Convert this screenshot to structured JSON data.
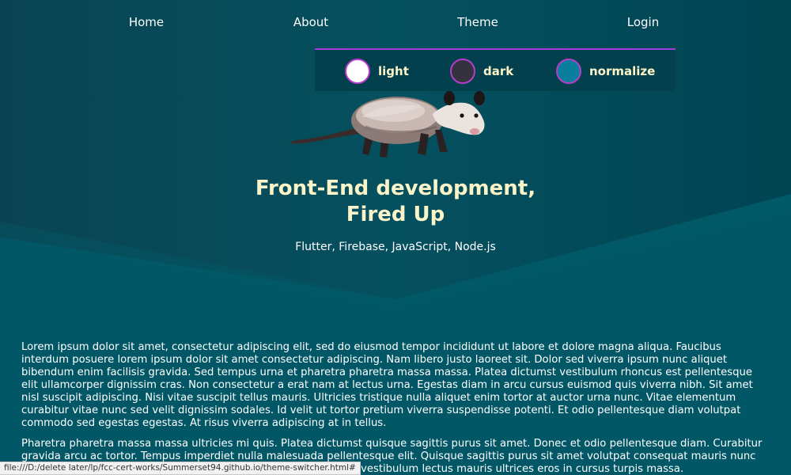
{
  "nav": {
    "items": [
      {
        "label": "Home"
      },
      {
        "label": "About"
      },
      {
        "label": "Theme"
      },
      {
        "label": "Login"
      }
    ]
  },
  "theme_switcher": {
    "options": [
      {
        "label": "light",
        "swatch_color": "#ffffff"
      },
      {
        "label": "dark",
        "swatch_color": "#33323e"
      },
      {
        "label": "normalize",
        "swatch_color": "#0a7f9d"
      }
    ],
    "accent_color": "#b43ec9"
  },
  "hero": {
    "image_icon": "opossum-image",
    "title_line1": "Front-End development,",
    "title_line2": "Fired Up",
    "subtitle": "Flutter, Firebase, JavaScript, Node.js"
  },
  "content": {
    "paragraph1": "Lorem ipsum dolor sit amet, consectetur adipiscing elit, sed do eiusmod tempor incididunt ut labore et dolore magna aliqua. Faucibus interdum posuere lorem ipsum dolor sit amet consectetur adipiscing. Nam libero justo laoreet sit. Dolor sed viverra ipsum nunc aliquet bibendum enim facilisis gravida. Sed tempus urna et pharetra pharetra massa massa. Platea dictumst vestibulum rhoncus est pellentesque elit ullamcorper dignissim cras. Non consectetur a erat nam at lectus urna. Egestas diam in arcu cursus euismod quis viverra nibh. Sit amet nisl suscipit adipiscing. Nisi vitae suscipit tellus mauris. Ultricies tristique nulla aliquet enim tortor at auctor urna nunc. Vitae elementum curabitur vitae nunc sed velit dignissim sodales. Id velit ut tortor pretium viverra suspendisse potenti. Et odio pellentesque diam volutpat commodo sed egestas egestas. At risus viverra adipiscing at in tellus.",
    "paragraph2": "Pharetra pharetra massa massa ultricies mi quis. Platea dictumst quisque sagittis purus sit amet. Donec et odio pellentesque diam. Curabitur gravida arcu ac tortor. Tempus imperdiet nulla malesuada pellentesque elit. Quisque sagittis purus sit amet volutpat consequat mauris nunc congue nisi vitae. Faucibus nullam eget felis eget nunc. Placerat vestibulum lectus mauris ultrices eros in cursus turpis massa."
  },
  "status_bar": {
    "url": "file:///D:/delete later/lp/fcc-cert-works/Summerset94.github.io/theme-switcher.html#"
  },
  "colors": {
    "background": "#005060",
    "title": "#fbf4c8",
    "panel": "#03404d",
    "panel_border": "#9b3fd6"
  }
}
